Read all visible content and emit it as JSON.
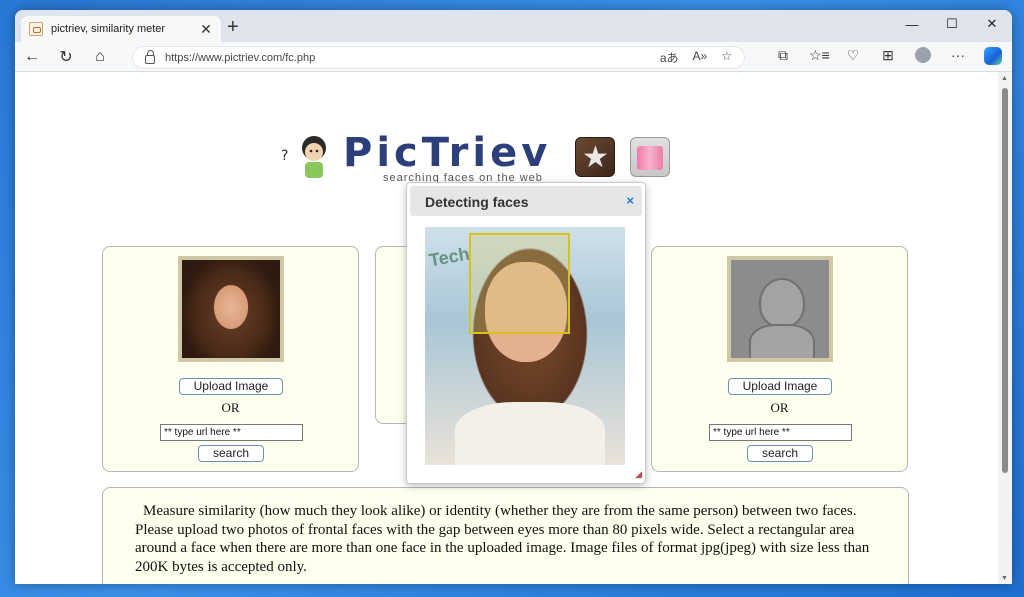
{
  "browser": {
    "tab_title": "pictriev, similarity meter",
    "tab_close": "✕",
    "new_tab": "+",
    "window_controls": {
      "minimize": "—",
      "maximize": "☐",
      "close": "✕"
    },
    "url": "https://www.pictriev.com/fc.php",
    "nav": {
      "back": "←",
      "reload": "↻",
      "home": "⌂"
    },
    "address_icons": [
      "aあ",
      "A»",
      "☆"
    ],
    "toolbar_icons": [
      "⧉",
      "☆≡",
      "♡",
      "⊞",
      "···"
    ]
  },
  "logo": {
    "name": "PicTriev",
    "tagline": "searching faces on the web"
  },
  "left_panel": {
    "upload_label": "Upload Image",
    "or_label": "OR",
    "url_value": "** type url here **",
    "search_label": "search"
  },
  "right_panel": {
    "upload_label": "Upload Image",
    "or_label": "OR",
    "url_value": "** type url here **",
    "search_label": "search"
  },
  "modal": {
    "title": "Detecting faces",
    "close": "×",
    "background_text": "Tech"
  },
  "description": "Measure similarity (how much they look alike) or identity (whether they are from the same person) between two faces. Please upload two photos of frontal faces with the gap between eyes more than 80 pixels wide. Select a rectangular area around a face when there are more than one face in the uploaded image. Image files of format jpg(jpeg) with size less than 200K bytes is accepted only."
}
